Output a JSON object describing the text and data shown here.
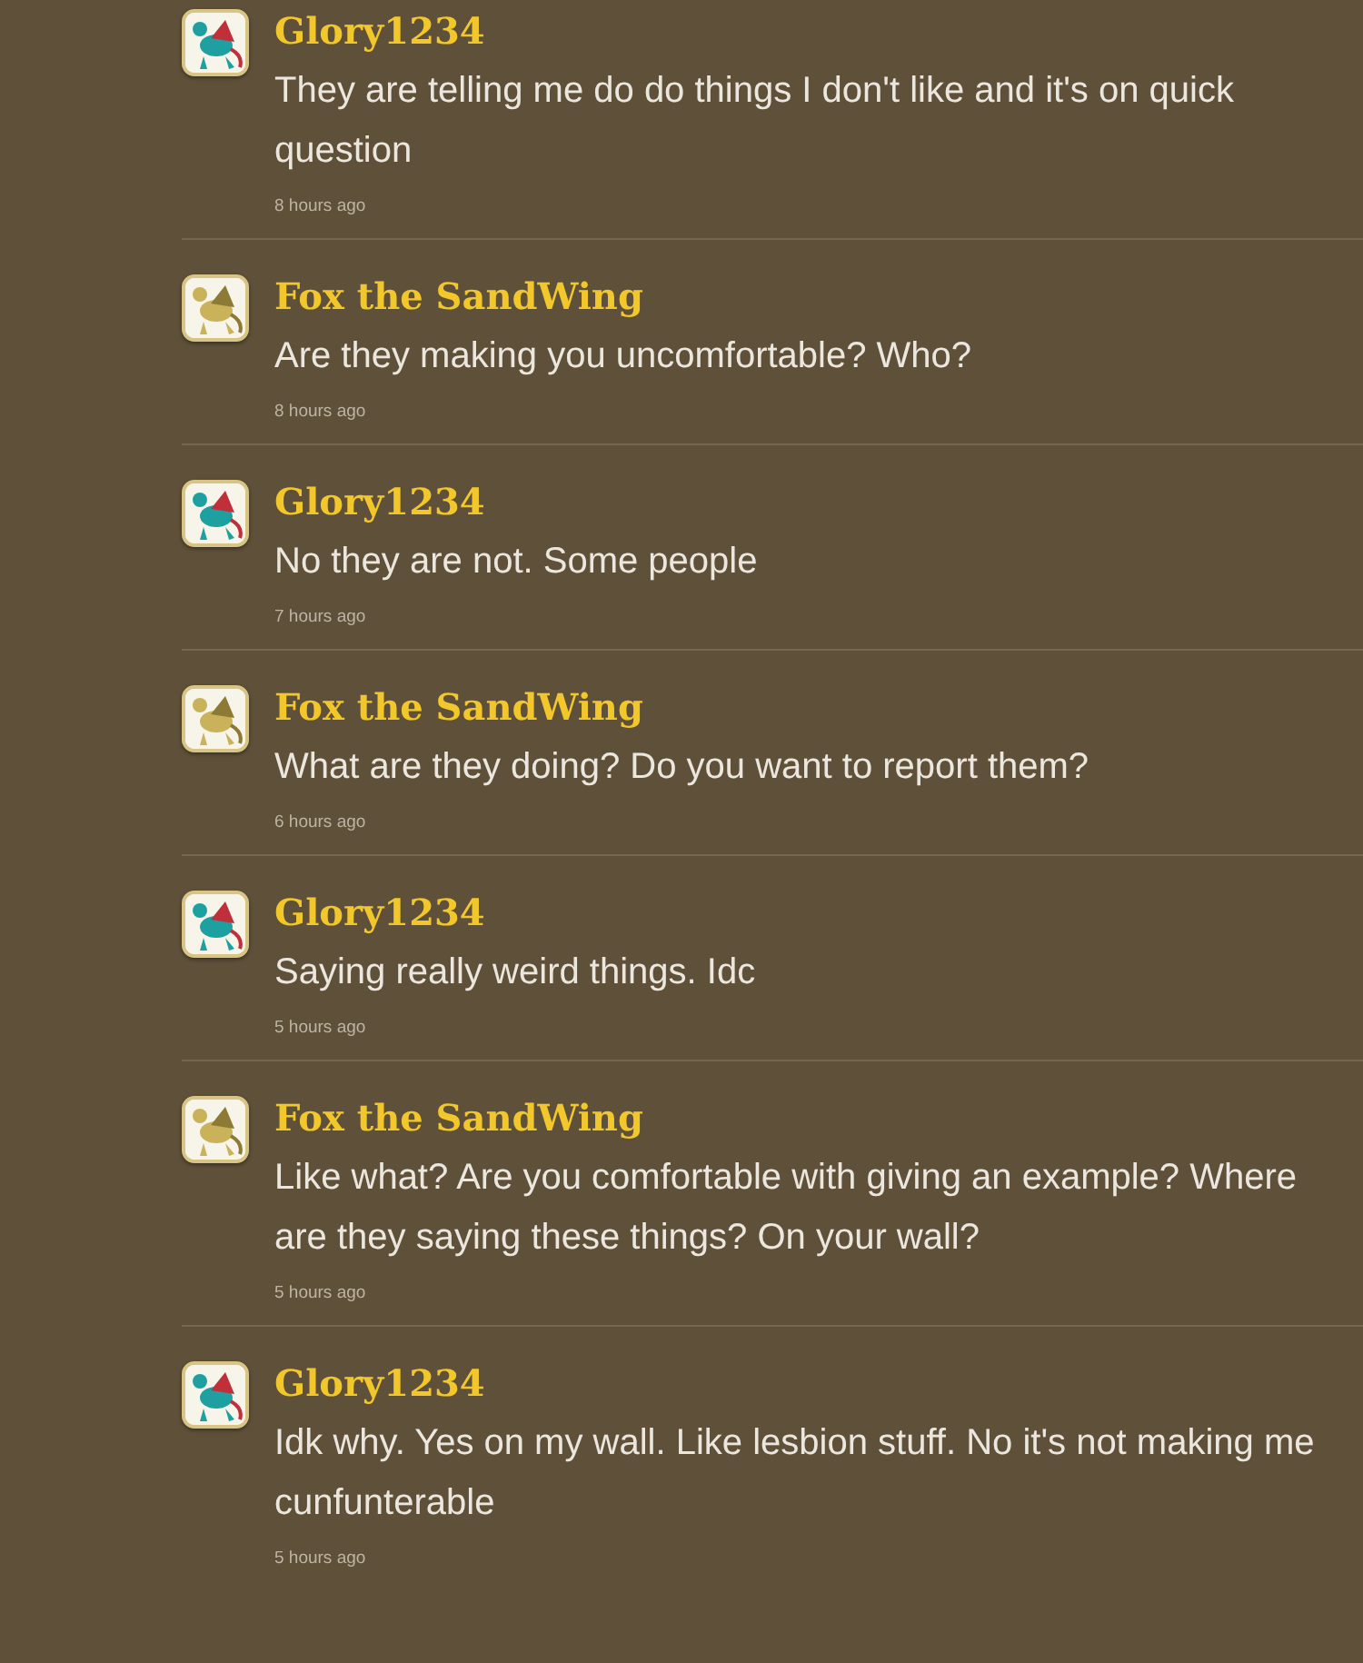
{
  "comments": [
    {
      "author": "Glory1234",
      "text": "They are telling me do do things I don't like and it's on quick question",
      "time": "8 hours ago"
    },
    {
      "author": "Fox the SandWing",
      "text": "Are they making you uncomfortable? Who?",
      "time": "8 hours ago"
    },
    {
      "author": "Glory1234",
      "text": "No they are not. Some people",
      "time": "7 hours ago"
    },
    {
      "author": "Fox the SandWing",
      "text": "What are they doing? Do you want to report them?",
      "time": "6 hours ago"
    },
    {
      "author": "Glory1234",
      "text": "Saying really weird things. Idc",
      "time": "5 hours ago"
    },
    {
      "author": "Fox the SandWing",
      "text": "Like what? Are you comfortable with giving an example? Where are they saying these things? On your wall?",
      "time": "5 hours ago"
    },
    {
      "author": "Glory1234",
      "text": "Idk why. Yes on my wall. Like lesbion stuff. No it's not making me cunfunterable",
      "time": "5 hours ago"
    }
  ]
}
